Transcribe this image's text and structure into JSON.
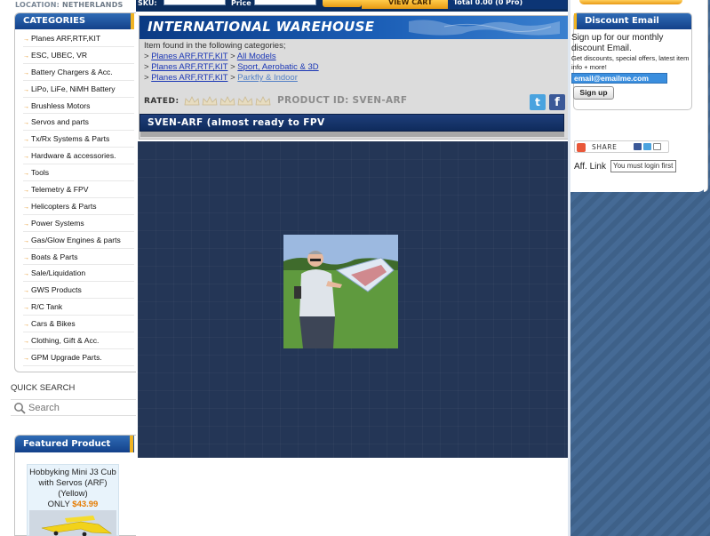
{
  "location": {
    "label": "LOCATION:",
    "value": "NETHERLANDS"
  },
  "categories": {
    "title": "CATEGORIES",
    "items": [
      "Planes ARF,RTF,KIT",
      "ESC, UBEC, VR",
      "Battery Chargers & Acc.",
      "LiPo, LiFe, NiMH Battery",
      "Brushless Motors",
      "Servos and parts",
      "Tx/Rx Systems & Parts",
      "Hardware & accessories.",
      "Tools",
      "Telemetry & FPV",
      "Helicopters & Parts",
      "Power Systems",
      "Gas/Glow Engines & parts",
      "Boats & Parts",
      "Sale/Liquidation",
      "GWS Products",
      "R/C Tank",
      "Cars & Bikes",
      "Clothing, Gift & Acc.",
      "GPM Upgrade Parts."
    ]
  },
  "quick_search": {
    "label": "QUICK SEARCH",
    "placeholder": "Search",
    "icon": "search-icon"
  },
  "featured": {
    "title": "Featured Product",
    "name": "Hobbyking Mini J3 Cub with Servos (ARF) (Yellow)",
    "price_prefix": "ONLY",
    "price": "$43.99"
  },
  "header_bar": {
    "search_label": "SKU:",
    "price_label": "Price",
    "view_cart": "VIEW CART",
    "cart_total": "Total 0.00 (0 Pro)"
  },
  "banner": {
    "title": "INTERNATIONAL WAREHOUSE"
  },
  "breadcrumbs": {
    "intro": "Item found in the following categories;",
    "rows": [
      {
        "prefix": ">",
        "parent": "Planes ARF,RTF,KIT",
        "sep": ">",
        "child": "All Models"
      },
      {
        "prefix": ">",
        "parent": "Planes ARF,RTF,KIT",
        "sep": ">",
        "child": "Sport, Aerobatic & 3D"
      },
      {
        "prefix": ">",
        "parent": "Planes ARF,RTF,KIT",
        "sep": ">",
        "child": "Parkfly & Indoor"
      }
    ]
  },
  "rating": {
    "label": "RATED:",
    "stars": 0,
    "max": 5
  },
  "product": {
    "id_label": "PRODUCT ID: SVEN-ARF",
    "title": "SVEN-ARF (almost ready to FPV"
  },
  "social": {
    "twitter": "t",
    "facebook": "f"
  },
  "discount_email": {
    "title": "Discount Email",
    "text": "Sign up for our monthly discount Email.",
    "small": "Get discounts, special offers, latest item info + more!",
    "input_value": "email@emailme.com",
    "button": "Sign up"
  },
  "share": {
    "label": "SHARE"
  },
  "affiliate": {
    "label": "Aff. Link",
    "value": "You must login first"
  },
  "colors": {
    "brand_blue": "#13418a",
    "accent_orange": "#f0b322",
    "price_orange": "#e57b00"
  }
}
